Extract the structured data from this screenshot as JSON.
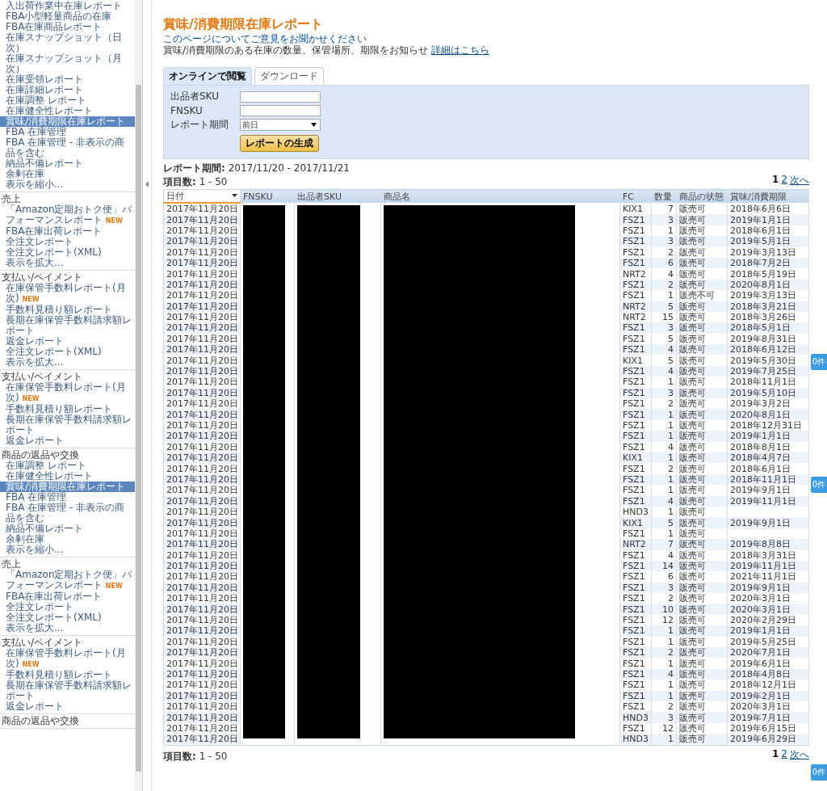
{
  "sidebar": {
    "sections": [
      {
        "items": [
          {
            "label": "入出荷作業中在庫レポート",
            "selected": false
          },
          {
            "label": "FBA小型軽量商品の在庫",
            "selected": false
          },
          {
            "label": "FBA在庫商品レポート",
            "selected": false
          },
          {
            "label": "在庫スナップショット（日次）",
            "selected": false
          },
          {
            "label": "在庫スナップショット（月次）",
            "selected": false
          },
          {
            "label": "在庫受領レポート",
            "selected": false
          },
          {
            "label": "在庫詳細レポート",
            "selected": false
          },
          {
            "label": "在庫調整 レポート",
            "selected": false
          },
          {
            "label": "在庫健全性レポート",
            "selected": false
          },
          {
            "label": "賞味/消費期限在庫レポート",
            "selected": true
          },
          {
            "label": "FBA 在庫管理",
            "selected": false
          },
          {
            "label": "FBA 在庫管理 - 非表示の商品を含む",
            "selected": false
          },
          {
            "label": "納品不備レポート",
            "selected": false
          },
          {
            "label": "余剰在庫",
            "selected": false
          },
          {
            "label": "表示を縮小...",
            "selected": false
          }
        ]
      },
      {
        "heading": "売上",
        "items": [
          {
            "label": "「Amazon定期おトク便」パフォーマンスレポート",
            "badge": "NEW",
            "selected": false
          },
          {
            "label": "FBA在庫出荷レポート",
            "selected": false
          },
          {
            "label": "全注文レポート",
            "selected": false
          },
          {
            "label": "全注文レポート(XML)",
            "selected": false
          },
          {
            "label": "表示を拡大...",
            "selected": false
          }
        ]
      },
      {
        "heading": "支払い/ペイメント",
        "items": [
          {
            "label": "在庫保管手数料レポート(月次)",
            "badge": "NEW",
            "selected": false
          },
          {
            "label": "手数料見積り額レポート",
            "selected": false
          },
          {
            "label": "長期在庫保管手数料請求額レポート",
            "selected": false
          },
          {
            "label": "返金レポート",
            "selected": false
          },
          {
            "label": "全注文レポート(XML)",
            "selected": false
          },
          {
            "label": "表示を拡大...",
            "selected": false
          }
        ]
      },
      {
        "heading": "支払い/ペイメント",
        "items": [
          {
            "label": "在庫保管手数料レポート(月次)",
            "badge": "NEW",
            "selected": false
          },
          {
            "label": "手数料見積り額レポート",
            "selected": false
          },
          {
            "label": "長期在庫保管手数料請求額レポート",
            "selected": false
          },
          {
            "label": "返金レポート",
            "selected": false
          }
        ]
      },
      {
        "heading": "商品の返品や交換",
        "items": [
          {
            "label": "在庫調整 レポート",
            "selected": false
          },
          {
            "label": "在庫健全性レポート",
            "selected": false
          },
          {
            "label": "賞味/消費期限在庫レポート",
            "selected": true
          },
          {
            "label": "FBA 在庫管理",
            "selected": false
          },
          {
            "label": "FBA 在庫管理 - 非表示の商品を含む",
            "selected": false
          },
          {
            "label": "納品不備レポート",
            "selected": false
          },
          {
            "label": "余剰在庫",
            "selected": false
          },
          {
            "label": "表示を縮小...",
            "selected": false
          }
        ]
      },
      {
        "heading": "売上",
        "items": [
          {
            "label": "「Amazon定期おトク便」パフォーマンスレポート",
            "badge": "NEW",
            "selected": false
          },
          {
            "label": "FBA在庫出荷レポート",
            "selected": false
          },
          {
            "label": "全注文レポート",
            "selected": false
          },
          {
            "label": "全注文レポート(XML)",
            "selected": false
          },
          {
            "label": "表示を拡大...",
            "selected": false
          }
        ]
      },
      {
        "heading": "支払い/ペイメント",
        "items": [
          {
            "label": "在庫保管手数料レポート(月次)",
            "badge": "NEW",
            "selected": false
          },
          {
            "label": "手数料見積り額レポート",
            "selected": false
          },
          {
            "label": "長期在庫保管手数料請求額レポート",
            "selected": false
          },
          {
            "label": "返金レポート",
            "selected": false
          }
        ]
      },
      {
        "heading": "商品の返品や交換"
      }
    ]
  },
  "page": {
    "title": "賞味/消費期限在庫レポート",
    "feedback_link": "このページについてご意見をお聞かせください",
    "description": "賞味/消費期限のある在庫の数量、保管場所、期限をお知らせ",
    "details_link": "詳細はこちら"
  },
  "tabs": [
    {
      "label": "オンラインで閲覧",
      "selected": true
    },
    {
      "label": "ダウンロード",
      "selected": false
    }
  ],
  "form": {
    "fields": [
      {
        "kind": "text",
        "label": "出品者SKU"
      },
      {
        "kind": "text",
        "label": "FNSKU"
      },
      {
        "kind": "select",
        "label": "レポート期間",
        "value": "前日"
      }
    ],
    "button": "レポートの生成"
  },
  "report_period": "**レポート期間:** 2017/11/20 - 2017/11/21",
  "item_count_top": "**項目数:** 1 - 50",
  "pagination_top": [
    {
      "label": "1",
      "selected": true
    },
    {
      "label": "2",
      "selected": false
    },
    {
      "label": "次へ",
      "selected": false
    }
  ],
  "table": {
    "columns": [
      {
        "label": "日付",
        "sorted": true
      },
      {
        "label": "FNSKU",
        "sorted": false,
        "redacted": true
      },
      {
        "label": "出品者SKU",
        "sorted": false,
        "redacted": true
      },
      {
        "label": "商品名",
        "sorted": false,
        "redacted": true
      },
      {
        "label": "FC",
        "sorted": false
      },
      {
        "label": "数量",
        "sorted": false
      },
      {
        "label": "商品の状態",
        "sorted": false
      },
      {
        "label": "賞味/消費期限",
        "sorted": false
      }
    ],
    "rows": [
      {
        "date": "2017年11月20日",
        "fc": "KIX1",
        "qty": "7",
        "condition": "販売可",
        "expiry": "2018年6月6日"
      },
      {
        "date": "2017年11月20日",
        "fc": "FSZ1",
        "qty": "3",
        "condition": "販売可",
        "expiry": "2019年1月1日"
      },
      {
        "date": "2017年11月20日",
        "fc": "FSZ1",
        "qty": "1",
        "condition": "販売可",
        "expiry": "2018年6月1日"
      },
      {
        "date": "2017年11月20日",
        "fc": "FSZ1",
        "qty": "3",
        "condition": "販売可",
        "expiry": "2019年5月1日"
      },
      {
        "date": "2017年11月20日",
        "fc": "FSZ1",
        "qty": "2",
        "condition": "販売可",
        "expiry": "2019年3月13日"
      },
      {
        "date": "2017年11月20日",
        "fc": "FSZ1",
        "qty": "6",
        "condition": "販売可",
        "expiry": "2018年7月2日"
      },
      {
        "date": "2017年11月20日",
        "fc": "NRT2",
        "qty": "4",
        "condition": "販売可",
        "expiry": "2018年5月19日"
      },
      {
        "date": "2017年11月20日",
        "fc": "FSZ1",
        "qty": "2",
        "condition": "販売可",
        "expiry": "2020年8月1日"
      },
      {
        "date": "2017年11月20日",
        "fc": "FSZ1",
        "qty": "1",
        "condition": "販売不可",
        "expiry": "2019年3月13日"
      },
      {
        "date": "2017年11月20日",
        "fc": "NRT2",
        "qty": "5",
        "condition": "販売可",
        "expiry": "2018年3月21日"
      },
      {
        "date": "2017年11月20日",
        "fc": "NRT2",
        "qty": "15",
        "condition": "販売可",
        "expiry": "2018年3月26日"
      },
      {
        "date": "2017年11月20日",
        "fc": "FSZ1",
        "qty": "3",
        "condition": "販売可",
        "expiry": "2018年5月1日"
      },
      {
        "date": "2017年11月20日",
        "fc": "FSZ1",
        "qty": "5",
        "condition": "販売可",
        "expiry": "2019年8月31日"
      },
      {
        "date": "2017年11月20日",
        "fc": "FSZ1",
        "qty": "4",
        "condition": "販売可",
        "expiry": "2018年6月12日"
      },
      {
        "date": "2017年11月20日",
        "fc": "KIX1",
        "qty": "5",
        "condition": "販売可",
        "expiry": "2019年5月30日"
      },
      {
        "date": "2017年11月20日",
        "fc": "FSZ1",
        "qty": "4",
        "condition": "販売可",
        "expiry": "2019年7月25日"
      },
      {
        "date": "2017年11月20日",
        "fc": "FSZ1",
        "qty": "1",
        "condition": "販売可",
        "expiry": "2018年11月1日"
      },
      {
        "date": "2017年11月20日",
        "fc": "FSZ1",
        "qty": "3",
        "condition": "販売可",
        "expiry": "2019年5月10日"
      },
      {
        "date": "2017年11月20日",
        "fc": "FSZ1",
        "qty": "2",
        "condition": "販売可",
        "expiry": "2019年3月2日"
      },
      {
        "date": "2017年11月20日",
        "fc": "FSZ1",
        "qty": "1",
        "condition": "販売可",
        "expiry": "2020年8月1日"
      },
      {
        "date": "2017年11月20日",
        "fc": "FSZ1",
        "qty": "1",
        "condition": "販売可",
        "expiry": "2018年12月31日"
      },
      {
        "date": "2017年11月20日",
        "fc": "FSZ1",
        "qty": "1",
        "condition": "販売可",
        "expiry": "2019年1月1日"
      },
      {
        "date": "2017年11月20日",
        "fc": "FSZ1",
        "qty": "4",
        "condition": "販売可",
        "expiry": "2018年8月1日"
      },
      {
        "date": "2017年11月20日",
        "fc": "KIX1",
        "qty": "1",
        "condition": "販売可",
        "expiry": "2018年4月7日"
      },
      {
        "date": "2017年11月20日",
        "fc": "FSZ1",
        "qty": "2",
        "condition": "販売可",
        "expiry": "2018年6月1日"
      },
      {
        "date": "2017年11月20日",
        "fc": "FSZ1",
        "qty": "1",
        "condition": "販売可",
        "expiry": "2018年11月1日"
      },
      {
        "date": "2017年11月20日",
        "fc": "FSZ1",
        "qty": "1",
        "condition": "販売可",
        "expiry": "2019年9月1日"
      },
      {
        "date": "2017年11月20日",
        "fc": "FSZ1",
        "qty": "4",
        "condition": "販売可",
        "expiry": "2019年11月1日"
      },
      {
        "date": "2017年11月20日",
        "fc": "HND3",
        "qty": "1",
        "condition": "販売可"
      },
      {
        "date": "2017年11月20日",
        "fc": "KIX1",
        "qty": "5",
        "condition": "販売可",
        "expiry": "2019年9月1日"
      },
      {
        "date": "2017年11月20日",
        "fc": "FSZ1",
        "qty": "1",
        "condition": "販売可"
      },
      {
        "date": "2017年11月20日",
        "fc": "NRT2",
        "qty": "7",
        "condition": "販売可",
        "expiry": "2019年8月8日"
      },
      {
        "date": "2017年11月20日",
        "fc": "FSZ1",
        "qty": "4",
        "condition": "販売可",
        "expiry": "2018年3月31日"
      },
      {
        "date": "2017年11月20日",
        "fc": "FSZ1",
        "qty": "14",
        "condition": "販売可",
        "expiry": "2019年11月1日"
      },
      {
        "date": "2017年11月20日",
        "fc": "FSZ1",
        "qty": "6",
        "condition": "販売可",
        "expiry": "2021年11月1日"
      },
      {
        "date": "2017年11月20日",
        "fc": "FSZ1",
        "qty": "3",
        "condition": "販売可",
        "expiry": "2019年9月1日"
      },
      {
        "date": "2017年11月20日",
        "fc": "FSZ1",
        "qty": "2",
        "condition": "販売可",
        "expiry": "2020年3月1日"
      },
      {
        "date": "2017年11月20日",
        "fc": "FSZ1",
        "qty": "10",
        "condition": "販売可",
        "expiry": "2020年3月1日"
      },
      {
        "date": "2017年11月20日",
        "fc": "FSZ1",
        "qty": "12",
        "condition": "販売可",
        "expiry": "2020年2月29日"
      },
      {
        "date": "2017年11月20日",
        "fc": "FSZ1",
        "qty": "1",
        "condition": "販売可",
        "expiry": "2019年1月1日"
      },
      {
        "date": "2017年11月20日",
        "fc": "FSZ1",
        "qty": "1",
        "condition": "販売可",
        "expiry": "2019年5月25日"
      },
      {
        "date": "2017年11月20日",
        "fc": "FSZ1",
        "qty": "2",
        "condition": "販売可",
        "expiry": "2020年7月1日"
      },
      {
        "date": "2017年11月20日",
        "fc": "FSZ1",
        "qty": "1",
        "condition": "販売可",
        "expiry": "2019年6月1日"
      },
      {
        "date": "2017年11月20日",
        "fc": "FSZ1",
        "qty": "4",
        "condition": "販売可",
        "expiry": "2018年4月8日"
      },
      {
        "date": "2017年11月20日",
        "fc": "FSZ1",
        "qty": "1",
        "condition": "販売可",
        "expiry": "2018年12月1日"
      },
      {
        "date": "2017年11月20日",
        "fc": "FSZ1",
        "qty": "1",
        "condition": "販売可",
        "expiry": "2019年2月1日"
      },
      {
        "date": "2017年11月20日",
        "fc": "FSZ1",
        "qty": "2",
        "condition": "販売可",
        "expiry": "2020年3月1日"
      },
      {
        "date": "2017年11月20日",
        "fc": "HND3",
        "qty": "3",
        "condition": "販売可",
        "expiry": "2019年7月1日"
      },
      {
        "date": "2017年11月20日",
        "fc": "FSZ1",
        "qty": "12",
        "condition": "販売可",
        "expiry": "2019年6月15日"
      },
      {
        "date": "2017年11月20日",
        "fc": "HND3",
        "qty": "1",
        "condition": "販売可",
        "expiry": "2019年6月29日"
      }
    ]
  },
  "item_count_bottom": "**項目数:** 1 - 50",
  "pagination_bottom": [
    {
      "label": "1",
      "selected": true
    },
    {
      "label": "2",
      "selected": false
    },
    {
      "label": "次へ",
      "selected": false
    }
  ],
  "side_tabs": [
    "0件",
    "0件",
    "0件"
  ]
}
